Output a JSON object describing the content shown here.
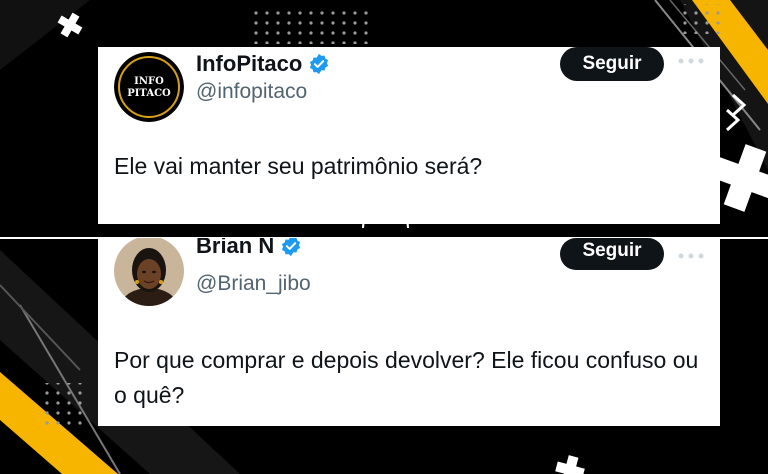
{
  "colors": {
    "accent_yellow": "#f7b500",
    "verified_blue": "#1d9bf0",
    "text_dark": "#0f1419",
    "text_muted": "#536471"
  },
  "tweets": [
    {
      "avatar_logo_lines": [
        "INFO",
        "PITACO"
      ],
      "name": "InfoPitaco",
      "verified": true,
      "handle": "@infopitaco",
      "follow_label": "Seguir",
      "more_icon": "more-dots-icon",
      "text": "Ele vai manter seu patrimônio será?"
    },
    {
      "name": "Brian N",
      "verified": true,
      "handle": "@Brian_jibo",
      "follow_label": "Seguir",
      "more_icon": "more-dots-icon",
      "text": "Por que comprar e depois devolver? Ele ficou confuso ou o quê?"
    }
  ]
}
